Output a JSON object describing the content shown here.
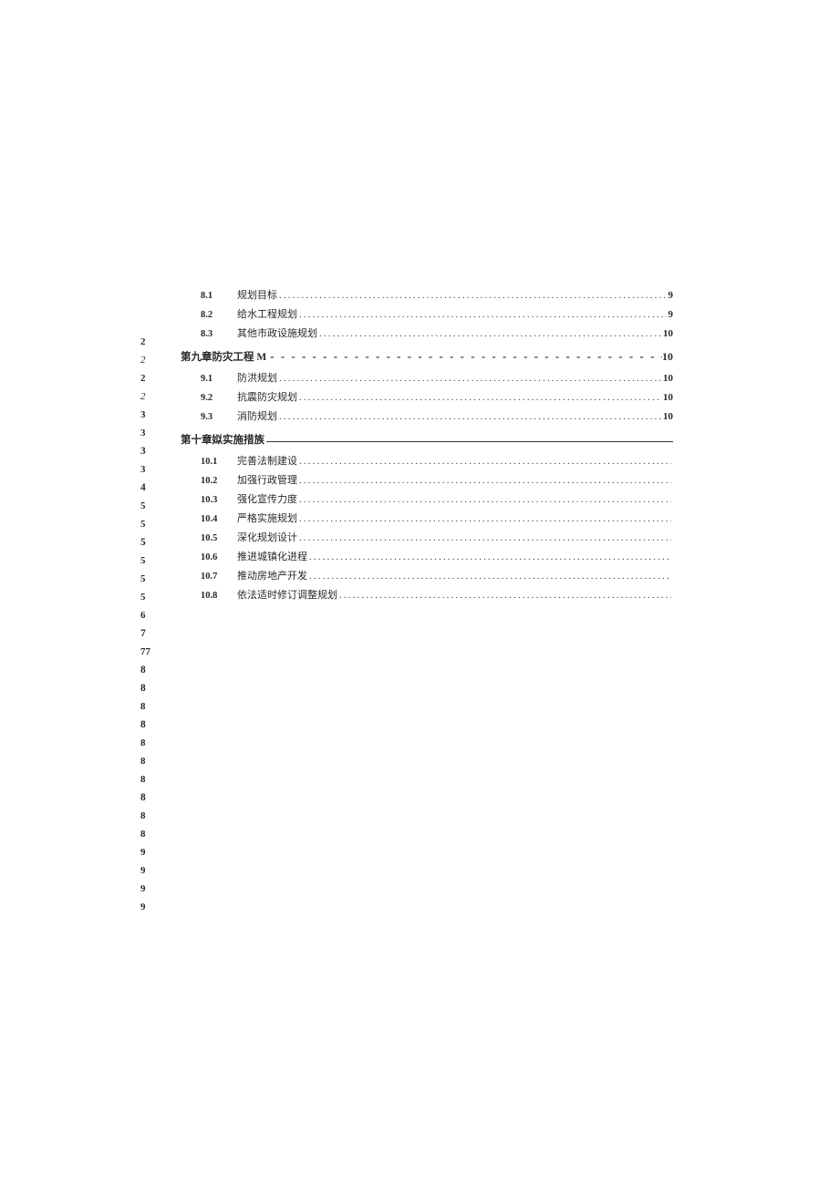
{
  "leftCol": [
    {
      "v": "2",
      "cls": ""
    },
    {
      "v": "2",
      "cls": "it"
    },
    {
      "v": "2",
      "cls": ""
    },
    {
      "v": "2",
      "cls": "it"
    },
    {
      "v": "3",
      "cls": ""
    },
    {
      "v": "3",
      "cls": ""
    },
    {
      "v": "3",
      "cls": "big"
    },
    {
      "v": "3",
      "cls": ""
    },
    {
      "v": "4",
      "cls": "big"
    },
    {
      "v": "5",
      "cls": ""
    },
    {
      "v": "5",
      "cls": ""
    },
    {
      "v": "5",
      "cls": "big"
    },
    {
      "v": "5",
      "cls": ""
    },
    {
      "v": "5",
      "cls": ""
    },
    {
      "v": "5",
      "cls": ""
    },
    {
      "v": "6",
      "cls": ""
    },
    {
      "v": "7",
      "cls": "big"
    },
    {
      "v": "77",
      "cls": ""
    },
    {
      "v": "8",
      "cls": "big"
    },
    {
      "v": "8",
      "cls": "big"
    },
    {
      "v": "8",
      "cls": ""
    },
    {
      "v": "8",
      "cls": "big"
    },
    {
      "v": "8",
      "cls": ""
    },
    {
      "v": "8",
      "cls": ""
    },
    {
      "v": "8",
      "cls": ""
    },
    {
      "v": "8",
      "cls": "big"
    },
    {
      "v": "8",
      "cls": ""
    },
    {
      "v": "8",
      "cls": ""
    },
    {
      "v": "9",
      "cls": ""
    },
    {
      "v": "9",
      "cls": ""
    },
    {
      "v": "9",
      "cls": ""
    },
    {
      "v": "9",
      "cls": ""
    }
  ],
  "dotFill": ". . . . . . . . . . . . . . . . . . . . . . . . . . . . . . . . . . . . . . . . . . . . . . . . . . . . . . . . . . . . . . . . . . . . . . . . . . . . . . . . . . . . . . . . . . . . . . . . . . . . . . . . . . . . . . . . . . . . . . . . . . . . . . . . . . . . . . . . . . . . . . .",
  "dashFill": "- - - - - - - - - - - - - - - - - - - - - - - - - - - - - - - - - - - - - - - - - - - - - -",
  "items": [
    {
      "type": "row",
      "num": "8.1",
      "txt": "规划目标",
      "pg": "9"
    },
    {
      "type": "row",
      "num": "8.2",
      "txt": "给水工程规划",
      "pg": "9"
    },
    {
      "type": "row",
      "num": "8.3",
      "txt": "其他市政设施规划",
      "pg": "10"
    },
    {
      "type": "chap",
      "style": "dash",
      "txt": "第九章防灾工程 M",
      "pg": "10"
    },
    {
      "type": "row",
      "num": "9.1",
      "txt": "防洪规划",
      "pg": "10"
    },
    {
      "type": "row",
      "num": "9.2",
      "txt": "抗震防灾规划",
      "pg": "10"
    },
    {
      "type": "row",
      "num": "9.3",
      "txt": "消防规划",
      "pg": "10"
    },
    {
      "type": "chap",
      "style": "line",
      "txt": "第十章姒实施措族",
      "pg": ""
    },
    {
      "type": "row",
      "num": "10.1",
      "txt": "完善法制建设",
      "pg": ""
    },
    {
      "type": "row",
      "num": "10.2",
      "txt": "加强行政管理",
      "pg": ""
    },
    {
      "type": "row",
      "num": "10.3",
      "txt": "强化宣传力度",
      "pg": ""
    },
    {
      "type": "row",
      "num": "10.4",
      "txt": "严格实施规划",
      "pg": ""
    },
    {
      "type": "row",
      "num": "10.5",
      "txt": "深化规划设计",
      "pg": ""
    },
    {
      "type": "row",
      "num": "10.6",
      "txt": "推进城镇化进程",
      "pg": ""
    },
    {
      "type": "row",
      "num": "10.7",
      "txt": "推动房地产开发",
      "pg": ""
    },
    {
      "type": "row",
      "num": "10.8",
      "txt": "依法适时修订调整规划",
      "pg": ""
    }
  ]
}
